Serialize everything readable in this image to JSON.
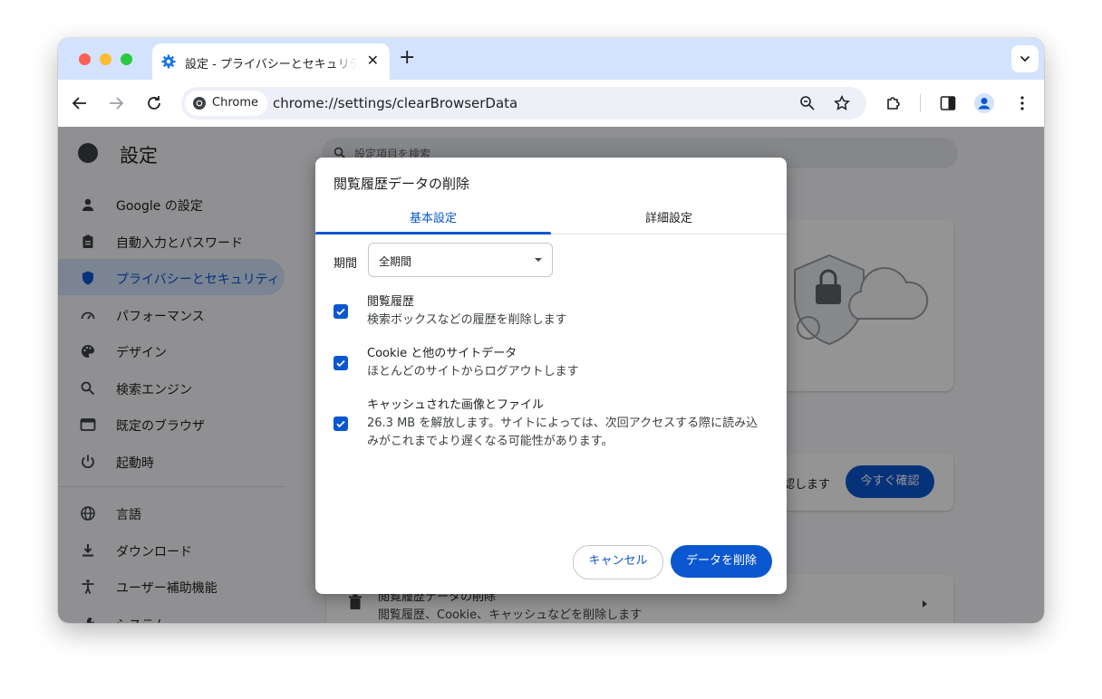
{
  "tab": {
    "title": "設定 - プライバシーとセキュリティ",
    "close": "✕",
    "new_tab": "+"
  },
  "omnibox": {
    "chip": "Chrome",
    "url": "chrome://settings/clearBrowserData"
  },
  "settings": {
    "title": "設定",
    "search_placeholder": "設定項目を検索",
    "nav": [
      {
        "label": "Google の設定",
        "icon": "person-icon"
      },
      {
        "label": "自動入力とパスワード",
        "icon": "clipboard-icon"
      },
      {
        "label": "プライバシーとセキュリティ",
        "icon": "shield-icon",
        "active": true
      },
      {
        "label": "パフォーマンス",
        "icon": "speedometer-icon"
      },
      {
        "label": "デザイン",
        "icon": "palette-icon"
      },
      {
        "label": "検索エンジン",
        "icon": "search-icon"
      },
      {
        "label": "既定のブラウザ",
        "icon": "browser-icon"
      },
      {
        "label": "起動時",
        "icon": "power-icon"
      },
      {
        "label": "言語",
        "icon": "globe-icon"
      },
      {
        "label": "ダウンロード",
        "icon": "download-icon"
      },
      {
        "label": "ユーザー補助機能",
        "icon": "accessibility-icon"
      },
      {
        "label": "システム",
        "icon": "wrench-icon"
      }
    ],
    "safety_text": "認します",
    "safety_button": "今すぐ確認",
    "clear_row_title": "閲覧履歴データの削除",
    "clear_row_subtitle": "閲覧履歴、Cookie、キャッシュなどを削除します"
  },
  "dialog": {
    "title": "閲覧履歴データの削除",
    "tabs": [
      {
        "label": "基本設定",
        "active": true
      },
      {
        "label": "詳細設定",
        "active": false
      }
    ],
    "period_label": "期間",
    "period_value": "全期間",
    "items": [
      {
        "title": "閲覧履歴",
        "desc": "検索ボックスなどの履歴を削除します",
        "checked": true
      },
      {
        "title": "Cookie と他のサイトデータ",
        "desc": "ほとんどのサイトからログアウトします",
        "checked": true
      },
      {
        "title": "キャッシュされた画像とファイル",
        "desc": "26.3 MB を解放します。サイトによっては、次回アクセスする際に読み込みがこれまでより遅くなる可能性があります。",
        "checked": true
      }
    ],
    "cancel": "キャンセル",
    "delete": "データを削除"
  },
  "colors": {
    "accent": "#0b57d0",
    "tabstrip": "#d3e3fd"
  }
}
